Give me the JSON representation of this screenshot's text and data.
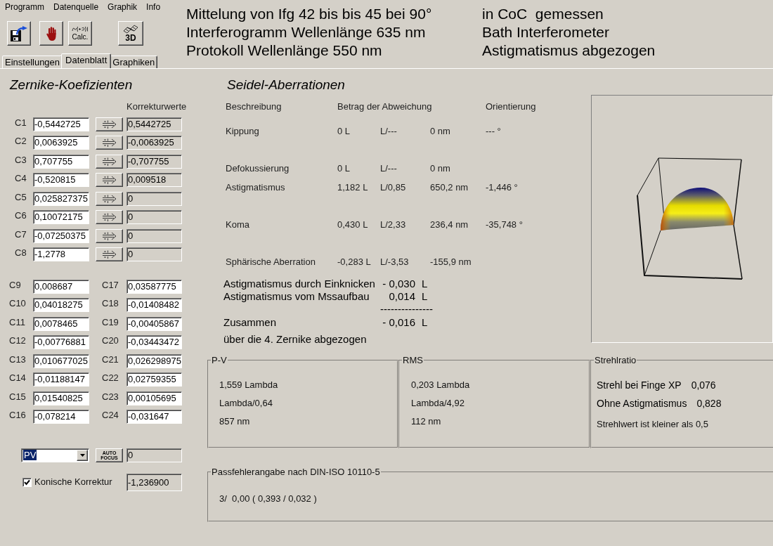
{
  "menu": [
    "Programm",
    "Datenquelle",
    "Graphik",
    "Info"
  ],
  "toolbar": [
    {
      "kind": "save"
    },
    {
      "kind": "hand"
    },
    {
      "kind": "calc",
      "label": "Calc."
    },
    {
      "kind": "view3d",
      "label": "3D"
    }
  ],
  "tabs": [
    {
      "label": "Einstellungen",
      "selected": false
    },
    {
      "label": "Datenblatt",
      "selected": true
    },
    {
      "label": "Graphiken",
      "selected": false
    }
  ],
  "header": [
    {
      "main": "Mittelung von Ifg 42 bis bis 45 bei 90°",
      "side": "in CoC  gemessen"
    },
    {
      "main": "Interferogramm Wellenlänge 635 nm",
      "side": "Bath Interferometer"
    },
    {
      "main": "Protokoll Wellenlänge 550 nm",
      "side": "Astigmatismus abgezogen"
    }
  ],
  "zernike": {
    "title": "Zernike-Koefizienten",
    "correction_heading": "Korrekturwerte",
    "coefficients": [
      {
        "label": "C1",
        "value": "-0,5442725",
        "correction": "0,5442725"
      },
      {
        "label": "C2",
        "value": "0,0063925",
        "correction": "-0,0063925"
      },
      {
        "label": "C3",
        "value": "0,707755",
        "correction": "-0,707755"
      },
      {
        "label": "C4",
        "value": "-0,520815",
        "correction": "0,009518"
      },
      {
        "label": "C5",
        "value": "0,025827375",
        "correction": "0"
      },
      {
        "label": "C6",
        "value": "0,10072175",
        "correction": "0"
      },
      {
        "label": "C7",
        "value": "-0,07250375",
        "correction": "0"
      },
      {
        "label": "C8",
        "value": "-1,2778",
        "correction": "0"
      }
    ],
    "higher_orders": [
      [
        {
          "label": "C9",
          "value": "0,008687"
        },
        {
          "label": "C17",
          "value": "0,03587775"
        }
      ],
      [
        {
          "label": "C10",
          "value": "0,04018275"
        },
        {
          "label": "C18",
          "value": "-0,01408482"
        }
      ],
      [
        {
          "label": "C11",
          "value": "0,0078465"
        },
        {
          "label": "C19",
          "value": "-0,00405867"
        }
      ],
      [
        {
          "label": "C12",
          "value": "-0,00776881"
        },
        {
          "label": "C20",
          "value": "-0,03443472"
        }
      ],
      [
        {
          "label": "C13",
          "value": "0,010677025"
        },
        {
          "label": "C21",
          "value": "0,026298975"
        }
      ],
      [
        {
          "label": "C14",
          "value": "-0,01188147"
        },
        {
          "label": "C22",
          "value": "0,02759355"
        }
      ],
      [
        {
          "label": "C15",
          "value": "0,01540825"
        },
        {
          "label": "C23",
          "value": "0,00105695"
        }
      ],
      [
        {
          "label": "C16",
          "value": "-0,078214"
        },
        {
          "label": "C24",
          "value": "-0,031647"
        }
      ]
    ],
    "mode": {
      "value": "PV"
    },
    "autofocus": {
      "label": [
        "AUTO",
        "FOCUS"
      ],
      "value": "0"
    },
    "conic": {
      "label": "Konische Korrektur",
      "checked": true,
      "value": "-1,236900"
    }
  },
  "seidel": {
    "title": "Seidel-Aberrationen",
    "columns": [
      "Beschreibung",
      "Betrag der Abweichung",
      "Orientierung"
    ],
    "rows": [
      {
        "name": "Kippung",
        "lambda": "0 L",
        "fraction": "L/---",
        "nm": "0 nm",
        "orientation": "--- °"
      },
      {
        "name": "Defokussierung",
        "lambda": "0 L",
        "fraction": "L/---",
        "nm": "0 nm"
      },
      {
        "name": "Astigmatismus",
        "lambda": "1,182 L",
        "fraction": "L/0,85",
        "nm": "650,2 nm",
        "orientation": "-1,446 °"
      },
      {
        "name": "Koma",
        "lambda": "0,430 L",
        "fraction": "L/2,33",
        "nm": "236,4 nm",
        "orientation": "-35,748 °"
      },
      {
        "name": "Sphärische Aberration",
        "lambda": "-0,283 L",
        "fraction": "L/-3,53",
        "nm": "-155,9 nm"
      }
    ],
    "summary": [
      {
        "label": "Astigmatismus durch Einknicken",
        "value": "- 0,030",
        "unit": "L"
      },
      {
        "label": "Astigmatismus vom Mssaufbau",
        "value": "0,014",
        "unit": "L"
      }
    ],
    "separator": "---------------",
    "total": {
      "label": "Zusammen",
      "value": "- 0,016",
      "unit": "L"
    },
    "note": "über die 4. Zernike abgezogen"
  },
  "pv": {
    "title": "P-V",
    "lines": [
      "1,559 Lambda",
      "Lambda/0,64",
      "857 nm"
    ]
  },
  "rms": {
    "title": "RMS",
    "lines": [
      "0,203 Lambda",
      "Lambda/4,92",
      "112 nm"
    ]
  },
  "strehl": {
    "title": "Strehlratio",
    "rows": [
      {
        "label": "Strehl bei Finge XP",
        "value": "0,076"
      },
      {
        "label": "Ohne Astigmatismus",
        "value": "0,828"
      }
    ],
    "note": "Strehlwert ist kleiner als 0,5"
  },
  "tolerance": {
    "title": "Passfehlerangabe nach DIN-ISO 10110-5",
    "value": "3/  0,00 ( 0,393 / 0,032 )"
  }
}
